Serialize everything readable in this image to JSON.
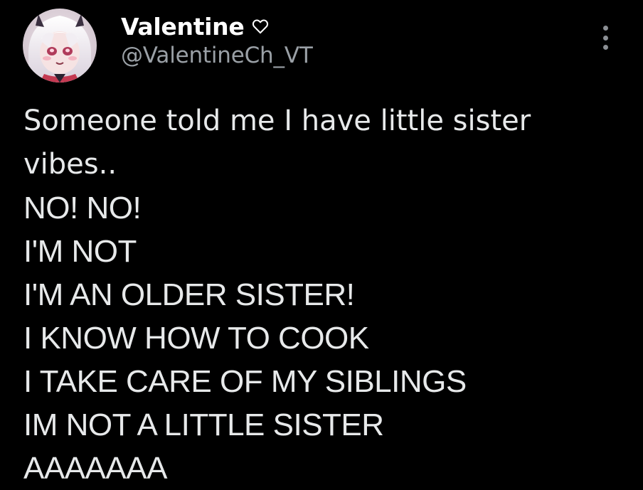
{
  "author": {
    "display_name": "Valentine",
    "handle": "@ValentineCh_VT",
    "name_icon": "heart-outline-icon",
    "avatar_icon": "avatar"
  },
  "menu": {
    "icon": "more-vertical-icon"
  },
  "tweet": {
    "lines": [
      "Someone told me I have little sister",
      "vibes..",
      "NO! NO!",
      "I'M NOT",
      "I'M AN OLDER SISTER!",
      "I KNOW HOW TO COOK",
      "I TAKE CARE OF MY SIBLINGS",
      "IM NOT A LITTLE SISTER",
      "AAAAAAA"
    ]
  },
  "colors": {
    "background": "#000000",
    "text": "#e7e9ea",
    "secondary_text": "#9aa0a6",
    "name": "#ffffff"
  }
}
